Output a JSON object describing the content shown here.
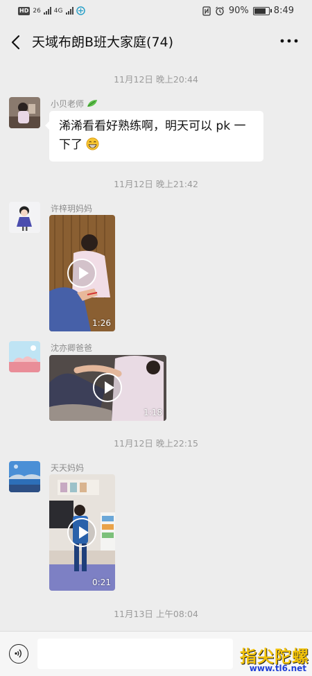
{
  "status_bar": {
    "left_badges": [
      "HD",
      "26",
      "4G"
    ],
    "battery_percent": 90,
    "battery_label": "90%",
    "time": "8:49"
  },
  "header": {
    "title": "天域布朗B班大家庭(74)",
    "back_icon": "chevron-left-icon",
    "more_icon": "more-dots-icon"
  },
  "messages": [
    {
      "kind": "timestamp",
      "text": "11月12日 晚上20:44"
    },
    {
      "kind": "text",
      "sender": "小贝老师",
      "sender_emoji": "leaf",
      "text": "浠浠看看好熟练啊，明天可以 pk 一下了",
      "trailing_emoji": "grinning"
    },
    {
      "kind": "timestamp",
      "text": "11月12日 晚上21:42"
    },
    {
      "kind": "video",
      "sender": "许梓玥妈妈",
      "duration": "1:26"
    },
    {
      "kind": "video",
      "sender": "沈亦卿爸爸",
      "duration": "1:18"
    },
    {
      "kind": "timestamp",
      "text": "11月12日 晚上22:15"
    },
    {
      "kind": "video",
      "sender": "天天妈妈",
      "duration": "0:21"
    },
    {
      "kind": "timestamp",
      "text": "11月13日 上午08:04"
    }
  ],
  "input_bar": {
    "voice_icon": "voice-icon",
    "input_value": "",
    "placeholder": ""
  },
  "watermark": {
    "logo_text": "指尖陀螺",
    "url": "www.tl6.net"
  }
}
